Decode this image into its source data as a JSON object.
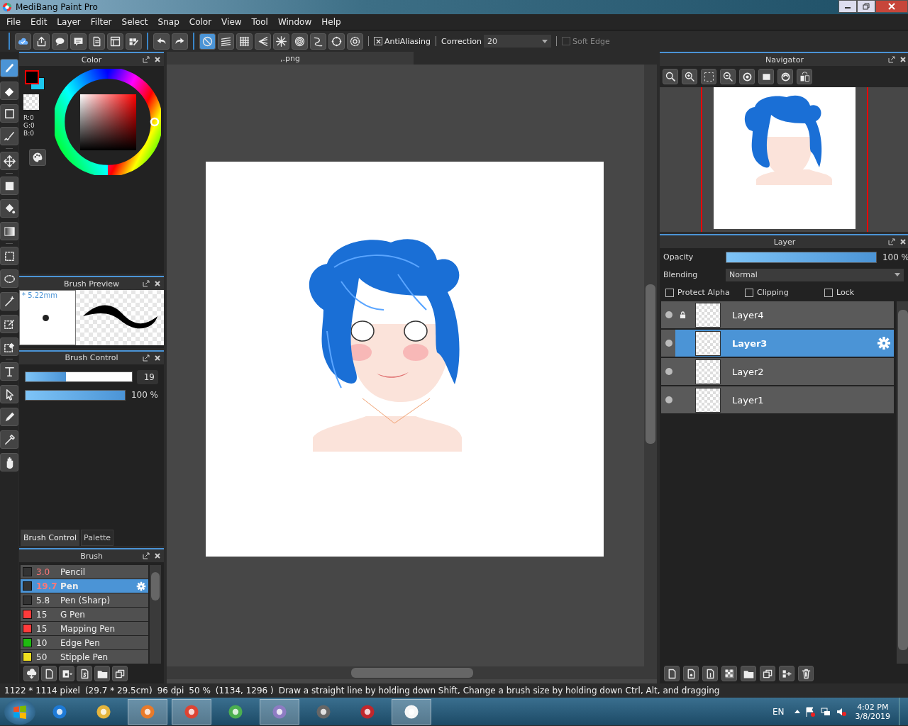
{
  "window": {
    "title": "MediBang Paint Pro"
  },
  "menu": [
    "File",
    "Edit",
    "Layer",
    "Filter",
    "Select",
    "Snap",
    "Color",
    "View",
    "Tool",
    "Window",
    "Help"
  ],
  "toolbar": {
    "snaps": [
      {
        "kind": "none",
        "selected": true
      },
      {
        "kind": "parallel",
        "selected": false
      },
      {
        "kind": "grid",
        "selected": false
      },
      {
        "kind": "perspective",
        "selected": false
      },
      {
        "kind": "radial",
        "selected": false
      },
      {
        "kind": "circle",
        "selected": false
      },
      {
        "kind": "curve",
        "selected": false
      },
      {
        "kind": "ellipse",
        "selected": false
      },
      {
        "kind": "gear",
        "selected": false
      }
    ],
    "antialiasing": {
      "label": "AntiAliasing",
      "checked": true
    },
    "correction": {
      "label": "Correction",
      "value": "20"
    },
    "soft_edge": {
      "label": "Soft Edge",
      "checked": false,
      "disabled": true
    }
  },
  "tools": [
    {
      "kind": "brush",
      "selected": true
    },
    {
      "kind": "eraser",
      "selected": false
    },
    {
      "kind": "rect",
      "selected": false
    },
    {
      "kind": "dotpen",
      "selected": false
    },
    {
      "kind": "move",
      "selected": false
    },
    {
      "kind": "fill",
      "selected": false
    },
    {
      "kind": "bucket",
      "selected": false
    },
    {
      "kind": "gradient",
      "selected": false
    },
    {
      "kind": "selrect",
      "selected": false
    },
    {
      "kind": "lasso",
      "selected": false
    },
    {
      "kind": "wand",
      "selected": false
    },
    {
      "kind": "selpen",
      "selected": false
    },
    {
      "kind": "selerase",
      "selected": false
    },
    {
      "kind": "text",
      "selected": false
    },
    {
      "kind": "pointer",
      "selected": false
    },
    {
      "kind": "pen",
      "selected": false
    },
    {
      "kind": "dropper",
      "selected": false
    },
    {
      "kind": "hand",
      "selected": false
    }
  ],
  "color_panel": {
    "title": "Color",
    "values": [
      "R:0",
      "G:0",
      "B:0"
    ]
  },
  "brush_preview": {
    "title": "Brush Preview",
    "size": "* 5.22mm"
  },
  "brush_control": {
    "title": "Brush Control",
    "size_slider": {
      "level": 0.38,
      "value": "19"
    },
    "opacity_slider": {
      "level": 1,
      "value": "100 %"
    }
  },
  "panel_tabs": [
    {
      "label": "Brush Control",
      "selected": true
    },
    {
      "label": "Palette",
      "selected": false
    }
  ],
  "brush": {
    "title": "Brush",
    "items": [
      {
        "size": "3.0",
        "name": "Pencil",
        "color": "#333333",
        "size_marked": true,
        "selected": false
      },
      {
        "size": "19.7",
        "name": "Pen",
        "color": "#333333",
        "size_marked": true,
        "selected": true
      },
      {
        "size": "5.8",
        "name": "Pen (Sharp)",
        "color": "#333333",
        "size_marked": false,
        "selected": false
      },
      {
        "size": "15",
        "name": "G Pen",
        "color": "#ff3b3b",
        "size_marked": false,
        "selected": false
      },
      {
        "size": "15",
        "name": "Mapping Pen",
        "color": "#ff3b3b",
        "size_marked": false,
        "selected": false
      },
      {
        "size": "10",
        "name": "Edge Pen",
        "color": "#1fbb11",
        "size_marked": false,
        "selected": false
      },
      {
        "size": "50",
        "name": "Stipple Pen",
        "color": "#f0e020",
        "size_marked": false,
        "selected": false
      }
    ]
  },
  "canvas": {
    "tab": ",.png"
  },
  "navigator": {
    "title": "Navigator"
  },
  "layer_panel": {
    "title": "Layer",
    "opacity_label": "Opacity",
    "opacity": {
      "level": 1,
      "value": "100 %"
    },
    "blending_label": "Blending",
    "blending_value": "Normal",
    "options": [
      {
        "label": "Protect Alpha",
        "checked": false
      },
      {
        "label": "Clipping",
        "checked": false
      },
      {
        "label": "Lock",
        "checked": false
      }
    ],
    "layers": [
      {
        "name": "Layer4",
        "selected": false,
        "locked": true
      },
      {
        "name": "Layer3",
        "selected": true,
        "locked": false
      },
      {
        "name": "Layer2",
        "selected": false,
        "locked": false
      },
      {
        "name": "Layer1",
        "selected": false,
        "locked": false
      }
    ]
  },
  "status_bar": [
    "1122 * 1114 pixel",
    "(29.7 * 29.5cm)",
    "96 dpi",
    "50 %",
    "(1134, 1296 )",
    "Draw a straight line by holding down Shift, Change a brush size by holding down Ctrl, Alt, and dragging"
  ],
  "taskbar": {
    "language": "EN",
    "time": "4:02 PM",
    "date": "3/8/2019"
  }
}
